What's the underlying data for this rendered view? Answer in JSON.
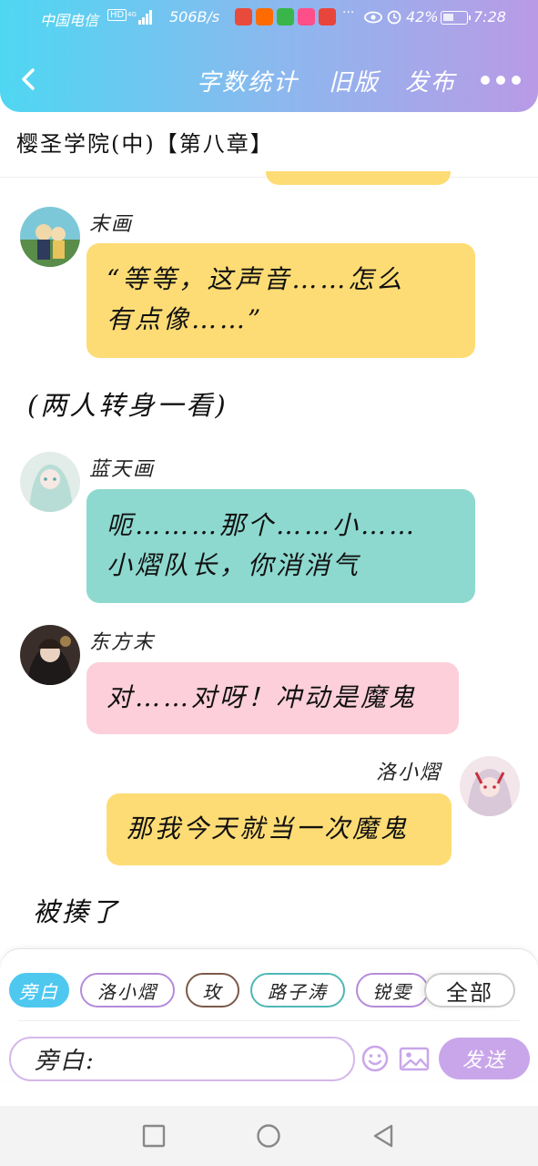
{
  "status_bar": {
    "carrier": "中国电信",
    "hd": "HD",
    "speed": "506B/s",
    "battery": "42%",
    "time": "7:28",
    "colors": {
      "app1": "#e84b3c",
      "app2": "#ff6b00",
      "app3": "#3ab54a",
      "app4": "#ff4f8b",
      "app5": "#e8453c"
    }
  },
  "navbar": {
    "count_label": "字数统计",
    "old_label": "旧版",
    "publish_label": "发布"
  },
  "document": {
    "title": "樱圣学院(中)【第八章】"
  },
  "messages": [
    {
      "speaker": "末画",
      "text_line1": "“等等，这声音……怎么",
      "text_line2": "有点像……”"
    },
    {
      "narration": "(两人转身一看)"
    },
    {
      "speaker": "蓝天画",
      "text_line1": "呃………那个……小……",
      "text_line2": "小熠队长，你消消气"
    },
    {
      "speaker": "东方末",
      "text_line1": "对……对呀！冲动是魔鬼"
    },
    {
      "speaker": "洛小熠",
      "text_line1": "那我今天就当一次魔鬼"
    },
    {
      "narration": "被揍了"
    }
  ],
  "roles": [
    {
      "label": "旁白"
    },
    {
      "label": "洛小熠"
    },
    {
      "label": "玫"
    },
    {
      "label": "路子涛"
    },
    {
      "label": "锐雯"
    },
    {
      "label": "全部"
    }
  ],
  "composer": {
    "prefix": "旁白:",
    "send_label": "发送"
  },
  "theme": {
    "yellow": "#fedc75",
    "teal": "#8dd9cf",
    "pink": "#fccfda",
    "accent_blue": "#4fc8f0",
    "accent_purple": "#c9a6ea"
  }
}
